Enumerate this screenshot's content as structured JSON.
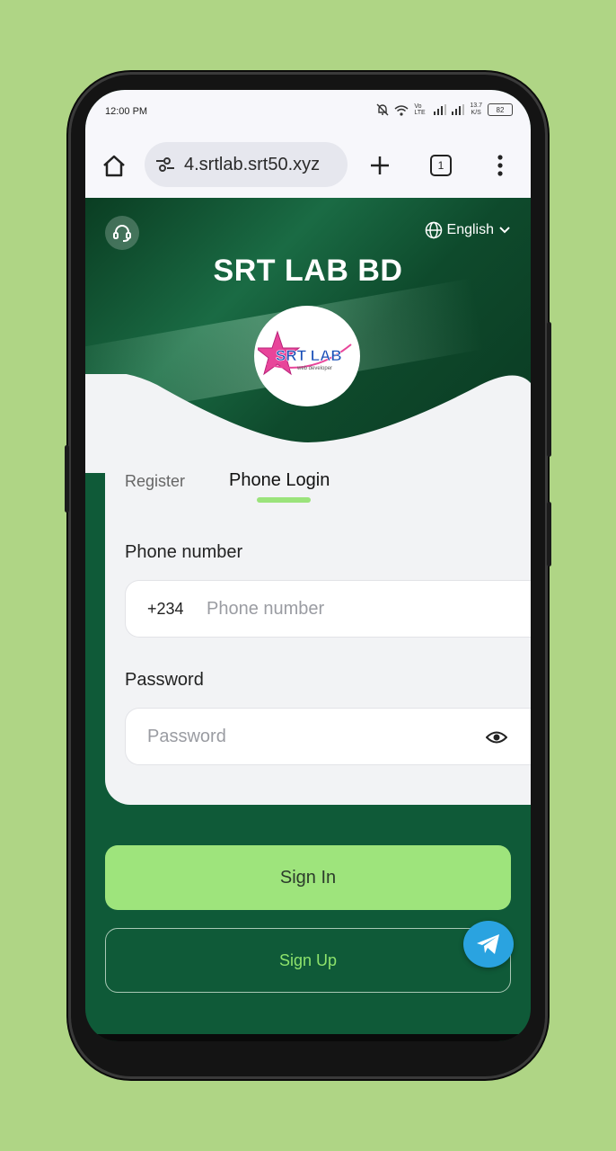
{
  "status": {
    "time": "12:00 PM",
    "speed": "13.7",
    "speed_unit": "K/S",
    "battery": "82",
    "network": "Vo LTE"
  },
  "browser": {
    "url": "4.srtlab.srt50.xyz",
    "tab_count": "1"
  },
  "header": {
    "language": "English",
    "title": "SRT LAB BD",
    "logo_text": "SRT LAB",
    "logo_sub": "web developer"
  },
  "tabs": {
    "register": "Register",
    "phone_login": "Phone Login"
  },
  "form": {
    "phone_label": "Phone number",
    "country_code": "+234",
    "phone_placeholder": "Phone number",
    "password_label": "Password",
    "password_placeholder": "Password"
  },
  "actions": {
    "sign_in": "Sign In",
    "sign_up": "Sign Up"
  },
  "colors": {
    "background": "#afd585",
    "theme": "#0f5a38",
    "accent": "#9ee47c",
    "telegram": "#2aa3e0"
  }
}
